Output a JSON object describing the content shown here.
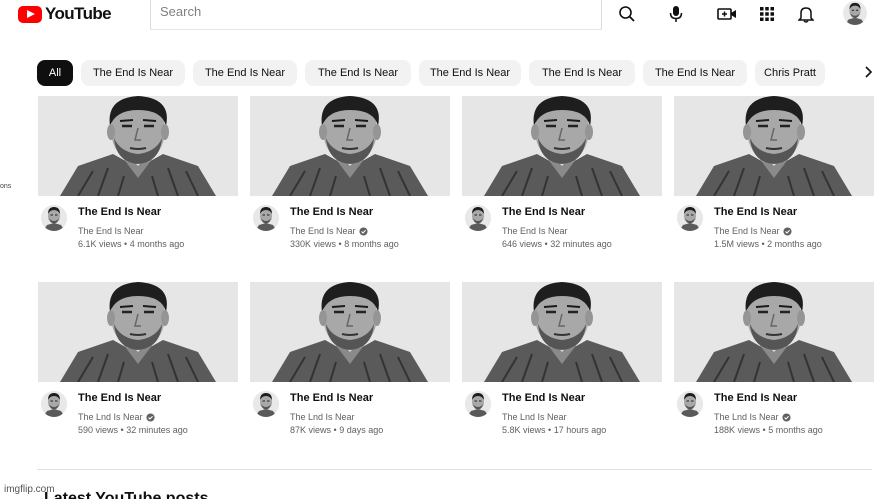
{
  "header": {
    "logo_text": "YouTube",
    "search_placeholder": "Search"
  },
  "chips": [
    "All",
    "The End Is Near",
    "The End Is Near",
    "The End Is Near",
    "The End Is Near",
    "The End Is Near",
    "The End Is Near",
    "Chris Pratt"
  ],
  "left_fragments": [
    "ons"
  ],
  "videos": [
    {
      "title": "The End Is Near",
      "channel": "The End Is Near",
      "verified": false,
      "views": "6.1K views",
      "age": "4 months ago"
    },
    {
      "title": "The End Is Near",
      "channel": "The End Is Near",
      "verified": true,
      "views": "330K views",
      "age": "8 months ago"
    },
    {
      "title": "The End Is Near",
      "channel": "The End Is Near",
      "verified": false,
      "views": "646 views",
      "age": "32 minutes ago"
    },
    {
      "title": "The End Is Near",
      "channel": "The End Is Near",
      "verified": true,
      "views": "1.5M views",
      "age": "2 months ago"
    },
    {
      "title": "The End Is Near",
      "channel": "The Lnd Is Near",
      "verified": true,
      "views": "590 views",
      "age": "32 minutes ago"
    },
    {
      "title": "The End Is Near",
      "channel": "The Lnd Is Near",
      "verified": false,
      "views": "87K views",
      "age": "9 days ago"
    },
    {
      "title": "The End Is Near",
      "channel": "The Lnd Is Near",
      "verified": false,
      "views": "5.8K views",
      "age": "17 hours ago"
    },
    {
      "title": "The End Is Near",
      "channel": "The Lnd Is Near",
      "verified": true,
      "views": "188K views",
      "age": "5 months ago"
    }
  ],
  "section_title": "Latest YouTube posts",
  "watermark": "imgflip.com",
  "colors": {
    "brand_red": "#ff0000",
    "chip_active": "#0f0f0f",
    "chip_bg": "#f2f2f2"
  },
  "icons": [
    "youtube-logo-icon",
    "search-icon",
    "mic-icon",
    "create-icon",
    "apps-icon",
    "bell-icon",
    "avatar",
    "chevron-right-icon",
    "verified-icon"
  ]
}
